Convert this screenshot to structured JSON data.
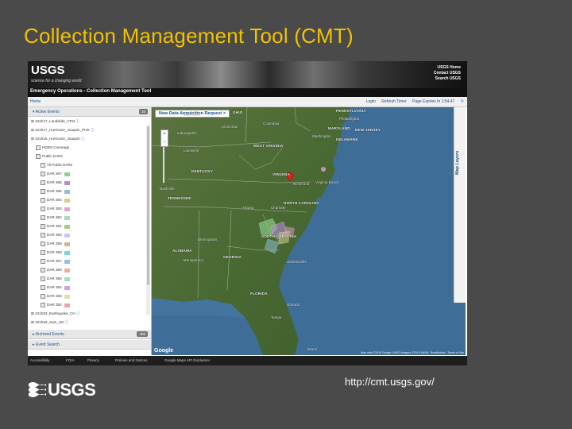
{
  "slide": {
    "title": "Collection Management Tool (CMT)",
    "url": "http://cmt.usgs.gov/",
    "logo_text": "USGS"
  },
  "header": {
    "logo": "USGS",
    "tagline": "science for a changing world",
    "links": [
      "USGS Home",
      "Contact USGS",
      "Search USGS"
    ],
    "app_title": "Emergency Operations - Collection Management Tool"
  },
  "nav": {
    "home": "Home",
    "links": [
      "Login",
      "Refresh Timer",
      "Page Expires In 1:54:47"
    ]
  },
  "sidebar": {
    "active_label": "Active Events",
    "active_count": "10",
    "tree": [
      {
        "text": "221h17_Landslide_VTM",
        "indent": 0,
        "kind": "event"
      },
      {
        "text": "221h17_Hurricane_Joaquin_PHS",
        "indent": 0,
        "kind": "event"
      },
      {
        "text": "221h15_Hurricane_Joaquin",
        "indent": 0,
        "kind": "event"
      },
      {
        "text": "HDDS Coverage",
        "indent": 1,
        "kind": "check"
      },
      {
        "text": "Public DARs",
        "indent": 1,
        "kind": "check"
      },
      {
        "text": "All Public DARs",
        "indent": 2,
        "kind": "check"
      }
    ],
    "dars": [
      {
        "text": "DAR 367",
        "color": "#8fd18a"
      },
      {
        "text": "DAR 366",
        "color": "#b58ad4"
      },
      {
        "text": "DAR 365",
        "color": "#8ac0d4"
      },
      {
        "text": "DAR 364",
        "color": "#d4d08a"
      },
      {
        "text": "DAR 363",
        "color": "#e8a0d0"
      },
      {
        "text": "DAR 362",
        "color": "#a6e0a6"
      },
      {
        "text": "DAR 361",
        "color": "#9ad47a"
      },
      {
        "text": "DAR 360",
        "color": "#c8c8f0"
      },
      {
        "text": "DAR 359",
        "color": "#d4b38a"
      },
      {
        "text": "DAR 358",
        "color": "#7ad4d4"
      },
      {
        "text": "DAR 357",
        "color": "#90c0f0"
      },
      {
        "text": "DAR 356",
        "color": "#f0b090"
      },
      {
        "text": "DAR 355",
        "color": "#a0e0c0"
      },
      {
        "text": "DAR 354",
        "color": "#d0a0e0"
      },
      {
        "text": "DAR 353",
        "color": "#e0e0a0"
      },
      {
        "text": "DAR 352",
        "color": "#f0a0b0"
      }
    ],
    "more_events": [
      "221h83_Earthquake_CH",
      "221h83_Sam_SD"
    ],
    "archived_label": "Archived Events",
    "archived_count": "408",
    "search_label": "Event Search"
  },
  "map": {
    "new_request": "New Data Acquisition Request >",
    "layers": "Map Layers",
    "google": "Google",
    "attribution": "Map data ©2015 Google, INEGI Imagery ©2015 NASA, TerraMetrics · Terms of Use",
    "labels": [
      {
        "text": "INDIANA",
        "cls": "st"
      },
      {
        "text": "OHIO",
        "cls": "st"
      },
      {
        "text": "PENNSYLVANIA",
        "cls": "st"
      },
      {
        "text": "Philadelphia",
        "cls": "ct"
      },
      {
        "text": "MARYLAND",
        "cls": "st"
      },
      {
        "text": "NEW JERSEY",
        "cls": "st"
      },
      {
        "text": "Washington",
        "cls": "ct"
      },
      {
        "text": "DELAWARE",
        "cls": "st"
      },
      {
        "text": "Indianapolis",
        "cls": "ct"
      },
      {
        "text": "Cincinnati",
        "cls": "ct"
      },
      {
        "text": "Columbus",
        "cls": "ct"
      },
      {
        "text": "WEST VIRGINIA",
        "cls": "st"
      },
      {
        "text": "Louisville",
        "cls": "ct"
      },
      {
        "text": "KENTUCKY",
        "cls": "st"
      },
      {
        "text": "VIRGINIA",
        "cls": "st"
      },
      {
        "text": "Richmond",
        "cls": "ct"
      },
      {
        "text": "Virginia Beach",
        "cls": "ct"
      },
      {
        "text": "Nashville",
        "cls": "ct"
      },
      {
        "text": "TENNESSEE",
        "cls": "st"
      },
      {
        "text": "NORTH CAROLINA",
        "cls": "st"
      },
      {
        "text": "Charlotte",
        "cls": "ct"
      },
      {
        "text": "SOUTH CAROLINA",
        "cls": "st"
      },
      {
        "text": "Atlanta",
        "cls": "ct"
      },
      {
        "text": "ALABAMA",
        "cls": "st"
      },
      {
        "text": "GEORGIA",
        "cls": "st"
      },
      {
        "text": "Birmingham",
        "cls": "ct"
      },
      {
        "text": "Montgomery",
        "cls": "ct"
      },
      {
        "text": "Jacksonville",
        "cls": "ct"
      },
      {
        "text": "FLORIDA",
        "cls": "st"
      },
      {
        "text": "Tampa",
        "cls": "ct"
      },
      {
        "text": "Orlando",
        "cls": "ct"
      },
      {
        "text": "Miami",
        "cls": "ct"
      }
    ]
  },
  "footer": {
    "links": [
      "Accessibility",
      "FOIA",
      "Privacy",
      "Policies and Notices",
      "Google Maps API Disclaimer"
    ]
  },
  "colors": {
    "title": "#f2c200",
    "link": "#1b4f8a",
    "ocean": "#3e6e98",
    "land": "#4f6b36"
  }
}
